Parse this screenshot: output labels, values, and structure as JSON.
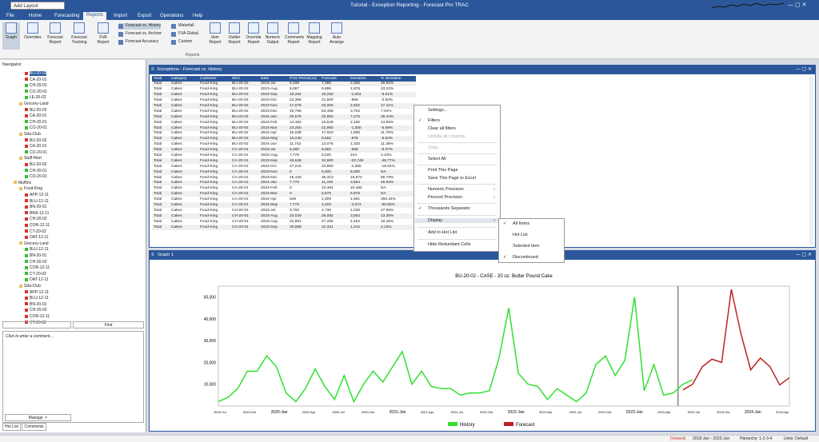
{
  "app": {
    "title": "Tutorial - Exception Reporting - Forecast Pro TRAC",
    "layout_value": "Add Layout"
  },
  "menu": [
    "File",
    "Home",
    "Forecasting",
    "Reports",
    "Import",
    "Export",
    "Operations",
    "Help"
  ],
  "ribbon": {
    "buttons": [
      "Graph",
      "Overrides",
      "Forecast Report",
      "Forecast Tracking",
      "FVA Report",
      "Item Report",
      "Outlier Report",
      "Override Report",
      "Numeric Output",
      "Comments Report",
      "Mapping Report",
      "Auto Arrange"
    ],
    "small": [
      "Forecast vs. History",
      "Forecast vs. Archive",
      "Forecast Accuracy",
      "Waterfall",
      "FVA Global",
      "Custom"
    ],
    "group_label": "Reports"
  },
  "navigator": {
    "title": "Navigator",
    "find": "Find",
    "comment_placeholder": "Click to enter a comment...",
    "manage": "Manage",
    "tabs": [
      "Hot List",
      "Comments"
    ],
    "items": [
      {
        "t": "BU-20-02",
        "lvl": 3,
        "c": "#d83030",
        "sel": true
      },
      {
        "t": "CA-20-01",
        "lvl": 3,
        "c": "#d83030"
      },
      {
        "t": "CH-20-01",
        "lvl": 3,
        "c": "#30c030"
      },
      {
        "t": "CO-20-01",
        "lvl": 3,
        "c": "#30c030"
      },
      {
        "t": "LE-20-02",
        "lvl": 3,
        "c": "#30c030"
      },
      {
        "t": "Grocery-Land",
        "lvl": 2,
        "c": "#e8c060"
      },
      {
        "t": "BU-20-02",
        "lvl": 3,
        "c": "#d83030"
      },
      {
        "t": "CA-20-01",
        "lvl": 3,
        "c": "#d83030"
      },
      {
        "t": "CH-20-01",
        "lvl": 3,
        "c": "#30c030"
      },
      {
        "t": "CO-20-01",
        "lvl": 3,
        "c": "#30c030"
      },
      {
        "t": "Sda-Club",
        "lvl": 2,
        "c": "#e8c060"
      },
      {
        "t": "BU-20-02",
        "lvl": 3,
        "c": "#d83030"
      },
      {
        "t": "CA-20-01",
        "lvl": 3,
        "c": "#d83030"
      },
      {
        "t": "CO-20-01",
        "lvl": 3,
        "c": "#30c030"
      },
      {
        "t": "Stuff-Mart",
        "lvl": 2,
        "c": "#e8c060"
      },
      {
        "t": "BU-20-02",
        "lvl": 3,
        "c": "#d83030"
      },
      {
        "t": "CH-20-01",
        "lvl": 3,
        "c": "#30c030"
      },
      {
        "t": "CO-20-01",
        "lvl": 3,
        "c": "#30c030"
      },
      {
        "t": "Muffins",
        "lvl": 1,
        "c": "#e8c060"
      },
      {
        "t": "Food-King",
        "lvl": 2,
        "c": "#e8c060"
      },
      {
        "t": "APP-12-11",
        "lvl": 3,
        "c": "#d83030"
      },
      {
        "t": "BLU-12-11",
        "lvl": 3,
        "c": "#d83030"
      },
      {
        "t": "BN-20-01",
        "lvl": 3,
        "c": "#d83030"
      },
      {
        "t": "BRA-12-11",
        "lvl": 3,
        "c": "#d83030"
      },
      {
        "t": "CH-20-02",
        "lvl": 3,
        "c": "#d83030"
      },
      {
        "t": "COR-12-11",
        "lvl": 3,
        "c": "#d83030"
      },
      {
        "t": "CT-20-02",
        "lvl": 3,
        "c": "#d83030"
      },
      {
        "t": "OAT-12-11",
        "lvl": 3,
        "c": "#d83030"
      },
      {
        "t": "Grocery-Land",
        "lvl": 2,
        "c": "#e8c060"
      },
      {
        "t": "BLU-12-11",
        "lvl": 3,
        "c": "#30c030"
      },
      {
        "t": "BN-20-01",
        "lvl": 3,
        "c": "#30c030"
      },
      {
        "t": "CH-20-02",
        "lvl": 3,
        "c": "#30c030"
      },
      {
        "t": "COR-12-11",
        "lvl": 3,
        "c": "#30c030"
      },
      {
        "t": "CT-20-02",
        "lvl": 3,
        "c": "#30c030"
      },
      {
        "t": "OAT-12-11",
        "lvl": 3,
        "c": "#30c030"
      },
      {
        "t": "Sda-Club",
        "lvl": 2,
        "c": "#e8c060"
      },
      {
        "t": "APP-12-11",
        "lvl": 3,
        "c": "#d83030"
      },
      {
        "t": "BLU-12-11",
        "lvl": 3,
        "c": "#d83030"
      },
      {
        "t": "BN-20-01",
        "lvl": 3,
        "c": "#d83030"
      },
      {
        "t": "CH-20-02",
        "lvl": 3,
        "c": "#d83030"
      },
      {
        "t": "COR-12-11",
        "lvl": 3,
        "c": "#d83030"
      },
      {
        "t": "CT-20-02",
        "lvl": 3,
        "c": "#d83030"
      }
    ]
  },
  "exceptions": {
    "title": "Exceptions - Forecast vs. History",
    "columns": [
      "Total",
      "Category",
      "Customer",
      "SKU",
      "Date",
      "Prior Period(12)",
      "Forecast",
      "Deviation",
      "% Deviation"
    ],
    "rows": [
      [
        "Total",
        "Cakes",
        "Food-King",
        "BU-20-02",
        "2023-Jul",
        "5,038",
        "7,385",
        "2,355",
        "46.82%"
      ],
      [
        "Total",
        "Cakes",
        "Food-King",
        "BU-20-02",
        "2023-Aug",
        "8,087",
        "9,965",
        "1,878",
        "23.22%"
      ],
      [
        "Total",
        "Cakes",
        "Food-King",
        "BU-20-02",
        "2023-Sep",
        "19,254",
        "18,250",
        "-1,004",
        "-5.21%"
      ],
      [
        "Total",
        "Cakes",
        "Food-King",
        "BU-20-02",
        "2023-Oct",
        "22,356",
        "21,500",
        "-856",
        "-3.83%"
      ],
      [
        "Total",
        "Cakes",
        "Food-King",
        "BU-20-02",
        "2023-Nov",
        "17,078",
        "20,000",
        "2,922",
        "17.11%"
      ],
      [
        "Total",
        "Cakes",
        "Food-King",
        "BU-20-02",
        "2023-Dec",
        "49,766",
        "53,468",
        "3,702",
        "7.44%"
      ],
      [
        "Total",
        "Cakes",
        "Food-King",
        "BU-20-02",
        "2024-Jan",
        "25,578",
        "32,853",
        "7,275",
        "28.44%"
      ],
      [
        "Total",
        "Cakes",
        "Food-King",
        "BU-20-02",
        "2024-Feb",
        "14,483",
        "16,648",
        "2,165",
        "14.95%"
      ],
      [
        "Total",
        "Cakes",
        "Food-King",
        "BU-20-02",
        "2024-Mar",
        "23,250",
        "21,950",
        "-1,300",
        "-5.59%"
      ],
      [
        "Total",
        "Cakes",
        "Food-King",
        "BU-20-02",
        "2024-Apr",
        "16,038",
        "17,923",
        "1,885",
        "11.75%"
      ],
      [
        "Total",
        "Cakes",
        "Food-King",
        "BU-20-02",
        "2024-May",
        "10,240",
        "9,662",
        "-578",
        "-5.64%"
      ],
      [
        "Total",
        "Cakes",
        "Food-King",
        "BU-20-02",
        "2024-Jun",
        "11,742",
        "13,075",
        "1,333",
        "11.35%"
      ],
      [
        "Total",
        "Cakes",
        "Food-King",
        "CA-20-01",
        "2023-Jul",
        "6,480",
        "6,892",
        "-588",
        "-9.07%"
      ],
      [
        "Total",
        "Cakes",
        "Food-King",
        "CA-20-01",
        "2023-Aug",
        "7,776",
        "8,020",
        "244",
        "3.13%"
      ],
      [
        "Total",
        "Cakes",
        "Food-King",
        "CA-20-01",
        "2023-Sep",
        "46,648",
        "23,900",
        "-22,748",
        "-48.77%"
      ],
      [
        "Total",
        "Cakes",
        "Food-King",
        "CA-20-01",
        "2023-Oct",
        "27,216",
        "22,850",
        "-4,366",
        "-16.04%"
      ],
      [
        "Total",
        "Cakes",
        "Food-King",
        "CA-20-01",
        "2023-Nov",
        "0",
        "5,000",
        "5,000",
        "NA"
      ],
      [
        "Total",
        "Cakes",
        "Food-King",
        "CA-20-01",
        "2023-Dec",
        "19,440",
        "36,313",
        "16,873",
        "86.79%"
      ],
      [
        "Total",
        "Cakes",
        "Food-King",
        "CA-20-01",
        "2024-Jan",
        "7,776",
        "11,340",
        "3,564",
        "45.83%"
      ],
      [
        "Total",
        "Cakes",
        "Food-King",
        "CA-20-01",
        "2024-Feb",
        "0",
        "10,484",
        "10,484",
        "NA"
      ],
      [
        "Total",
        "Cakes",
        "Food-King",
        "CA-20-01",
        "2024-Mar",
        "0",
        "6,676",
        "6,676",
        "NA"
      ],
      [
        "Total",
        "Cakes",
        "Food-King",
        "CA-20-01",
        "2024-Apr",
        "648",
        "2,309",
        "1,661",
        "256.34%"
      ],
      [
        "Total",
        "Cakes",
        "Food-King",
        "CA-20-01",
        "2024-May",
        "7,776",
        "3,203",
        "-4,573",
        "-58.80%"
      ],
      [
        "Total",
        "Cakes",
        "Food-King",
        "CH-20-01",
        "2023-Jul",
        "3,700",
        "4,736",
        "1,036",
        "27.99%"
      ],
      [
        "Total",
        "Cakes",
        "Food-King",
        "CH-20-01",
        "2023-Aug",
        "23,029",
        "26,092",
        "3,063",
        "13.30%"
      ],
      [
        "Total",
        "Cakes",
        "Food-King",
        "CH-20-01",
        "2023-Aug",
        "22,881",
        "27,335",
        "4,454",
        "19.46%"
      ],
      [
        "Total",
        "Cakes",
        "Food-King",
        "CH-20-01",
        "2023-Sep",
        "30,089",
        "31,331",
        "1,242",
        "4.13%"
      ]
    ]
  },
  "context_menu": {
    "items": [
      "Settings...",
      "Filters",
      "Clear all filters",
      "Unhide all columns",
      "Copy",
      "Select All",
      "Print This Page",
      "Save This Page to Excel",
      "Numeric Precision",
      "Percent Precision",
      "Thousands Separator",
      "Display",
      "Add to Hot List",
      "Hide Redundant Cells"
    ]
  },
  "submenu": {
    "items": [
      "All Items",
      "Hot List",
      "Selected Item",
      "Discontinued"
    ]
  },
  "graph": {
    "window_title": "Graph 1"
  },
  "chart_data": {
    "type": "line",
    "title": "BU-20-02 - CASE - 20 oz. Butter Pound Cake",
    "ylim": [
      0,
      55000
    ],
    "yticks": [
      10000,
      20000,
      30000,
      40000,
      50000
    ],
    "xticks": [
      "2019-Jul",
      "2019-Oct",
      "2020-Jan",
      "2020-Apr",
      "2020-Jul",
      "2020-Oct",
      "2021-Jan",
      "2021-Apr",
      "2021-Jul",
      "2021-Oct",
      "2022-Jan",
      "2022-Apr",
      "2022-Jul",
      "2022-Oct",
      "2023-Jan",
      "2023-Apr",
      "2023-Jul",
      "2023-Oct",
      "2024-Jan",
      "2024-Apr"
    ],
    "series": [
      {
        "name": "History",
        "color": "#30e030",
        "start": 0,
        "values": [
          2000,
          4000,
          8000,
          16000,
          16000,
          23000,
          18000,
          6000,
          2000,
          8000,
          17000,
          9000,
          3000,
          14000,
          2000,
          10000,
          16000,
          11000,
          18000,
          25000,
          10000,
          16000,
          9000,
          8000,
          8000,
          5000,
          6000,
          6000,
          7000,
          22000,
          45000,
          15000,
          10000,
          9000,
          3000,
          8000,
          5000,
          2000,
          6000,
          19000,
          23000,
          14000,
          21000,
          50000,
          7000,
          19000,
          5000,
          6000,
          10000,
          12000
        ]
      },
      {
        "name": "Forecast",
        "color": "#c02020",
        "start": 48,
        "values": [
          7400,
          10000,
          18000,
          21500,
          20000,
          53500,
          33000,
          16600,
          22000,
          18000,
          9700,
          13000
        ]
      }
    ]
  },
  "status": {
    "viewed": "[Viewed]",
    "range": "2018-Jan - 2023-Jun",
    "hierarchy": "Hierarchy: 1-2-3-4",
    "units": "Units: Default"
  }
}
